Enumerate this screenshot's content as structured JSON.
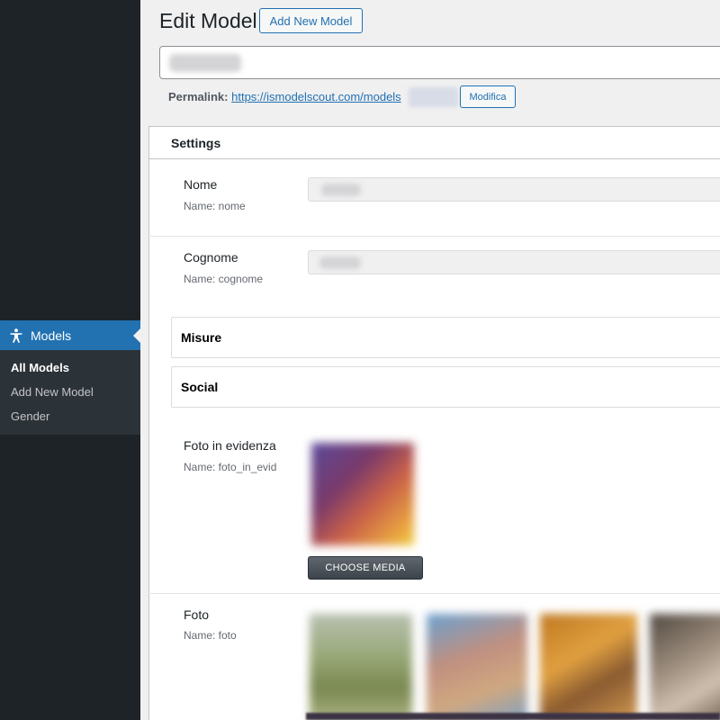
{
  "sidebar": {
    "menu_label": "Models",
    "menu_icon": "accessibility-person-icon",
    "submenu": [
      "All Models",
      "Add New Model",
      "Gender"
    ]
  },
  "header": {
    "title": "Edit Model",
    "add_new_label": "Add New Model"
  },
  "permalink": {
    "label": "Permalink:",
    "url": "https://ismodelscout.com/models",
    "edit_label": "Modifica"
  },
  "settings": {
    "title": "Settings",
    "fields": {
      "nome": {
        "label": "Nome",
        "name": "Name: nome"
      },
      "cognome": {
        "label": "Cognome",
        "name": "Name: cognome"
      },
      "foto_in_evidenza": {
        "label": "Foto in evidenza",
        "name": "Name: foto_in_evid",
        "button": "CHOOSE MEDIA"
      },
      "foto": {
        "label": "Foto",
        "name": "Name: foto"
      }
    },
    "groups": [
      "Misure",
      "Social"
    ]
  },
  "colors": {
    "sidebar_bg": "#1d2327",
    "accent": "#2271b1",
    "submenu_bg": "#2c3338"
  }
}
